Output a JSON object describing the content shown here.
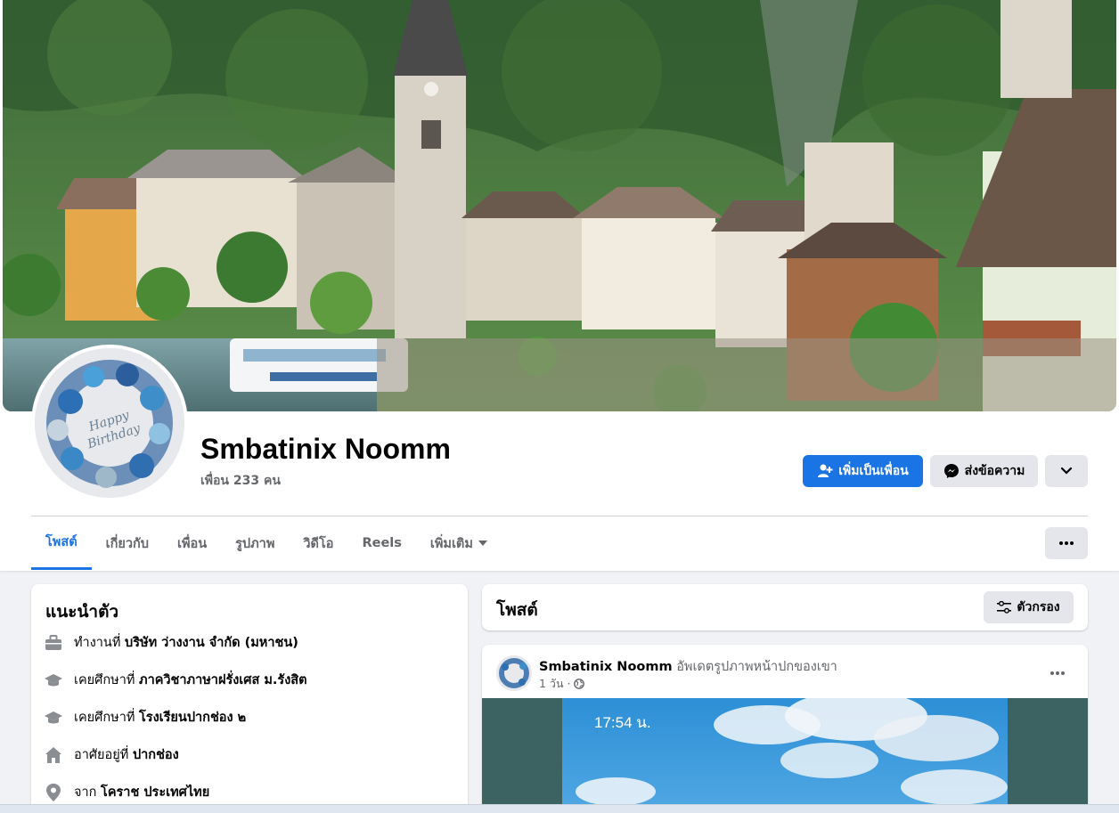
{
  "profile": {
    "name": "Smbatinix Noomm",
    "friends_count": "เพื่อน 233 คน"
  },
  "actions": {
    "add_friend": "เพิ่มเป็นเพื่อน",
    "message": "ส่งข้อความ"
  },
  "tabs": [
    {
      "label": "โพสต์",
      "active": true
    },
    {
      "label": "เกี่ยวกับ"
    },
    {
      "label": "เพื่อน"
    },
    {
      "label": "รูปภาพ"
    },
    {
      "label": "วิดีโอ"
    },
    {
      "label": "Reels"
    },
    {
      "label": "เพิ่มเติม"
    }
  ],
  "intro": {
    "title": "แนะนำตัว",
    "rows": [
      {
        "icon": "briefcase-icon",
        "prefix": "ทำงานที่",
        "value": "บริษัท ว่างงาน จำกัด (มหาชน)"
      },
      {
        "icon": "graduation-cap-icon",
        "prefix": "เคยศึกษาที่",
        "value": "ภาควิชาภาษาฝรั่งเศส ม.รังสิต"
      },
      {
        "icon": "graduation-cap-icon",
        "prefix": "เคยศึกษาที่",
        "value": "โรงเรียนปากช่อง ๒"
      },
      {
        "icon": "home-icon",
        "prefix": "อาศัยอยู่ที่",
        "value": "ปากช่อง"
      },
      {
        "icon": "location-pin-icon",
        "prefix": "จาก",
        "value": "โคราช ประเทศไทย"
      }
    ]
  },
  "posts": {
    "title": "โพสต์",
    "filter_label": "ตัวกรอง",
    "items": [
      {
        "author": "Smbatinix Noomm",
        "action": "อัพเดตรูปภาพหน้าปกของเขา",
        "time": "1 วัน ·",
        "image_time": "17:54 น."
      }
    ]
  },
  "colors": {
    "primary": "#1b74e4",
    "background": "#f0f2f5",
    "secondary_text": "#65676b",
    "button_gray": "#e4e6eb"
  }
}
